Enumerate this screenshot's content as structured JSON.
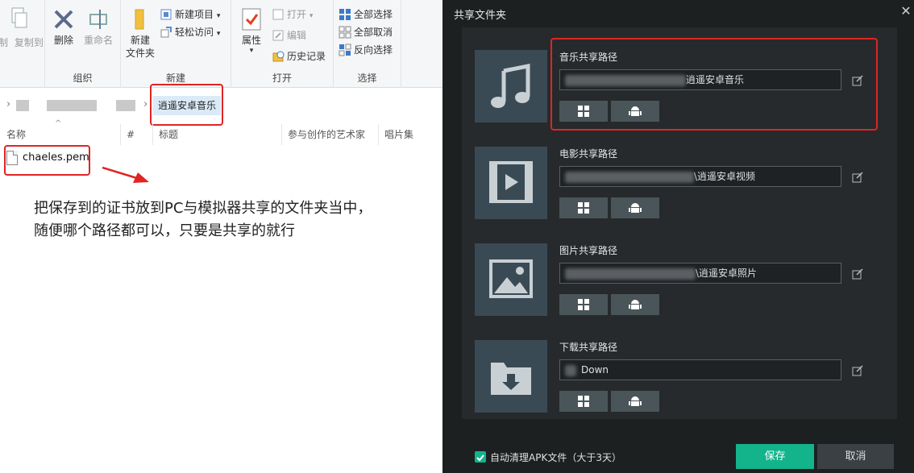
{
  "explorer": {
    "ribbon": {
      "clipboard_partial": [
        "制",
        "复制到"
      ],
      "organize": {
        "delete": "删除",
        "rename": "重命名",
        "group": "组织"
      },
      "new": {
        "new_folder_line1": "新建",
        "new_folder_line2": "文件夹",
        "new_item": "新建项目",
        "easy_access": "轻松访问",
        "group": "新建"
      },
      "open": {
        "properties": "属性",
        "open": "打开",
        "edit": "编辑",
        "history": "历史记录",
        "group": "打开"
      },
      "select": {
        "select_all": "全部选择",
        "select_none": "全部取消",
        "invert": "反向选择",
        "group": "选择"
      }
    },
    "address": {
      "current_folder": "逍遥安卓音乐"
    },
    "columns": {
      "name": "名称",
      "number": "#",
      "title": "标题",
      "artists": "参与创作的艺术家",
      "album": "唱片集"
    },
    "files": [
      {
        "name": "chaeles.pem"
      }
    ],
    "annotation": {
      "line1": "把保存到的证书放到PC与模拟器共享的文件夹当中，",
      "line2": "随便哪个路径都可以，只要是共享的就行"
    },
    "colors": {
      "highlight": "#e02424",
      "ribbon_bg": "#f5f6f7"
    }
  },
  "dialog": {
    "title": "共享文件夹",
    "close_icon": "close-icon",
    "rows": [
      {
        "label": "音乐共享路径",
        "path_tail": "逍遥安卓音乐",
        "icon": "music-note-icon"
      },
      {
        "label": "电影共享路径",
        "path_tail": "\\逍遥安卓视频",
        "icon": "video-icon"
      },
      {
        "label": "图片共享路径",
        "path_tail": "\\逍遥安卓照片",
        "icon": "image-icon"
      },
      {
        "label": "下载共享路径",
        "path_tail": "Down",
        "icon": "download-folder-icon"
      }
    ],
    "auto_clean": {
      "label": "自动清理APK文件（大于3天）",
      "checked": true
    },
    "buttons": {
      "save": "保存",
      "cancel": "取消"
    },
    "colors": {
      "background": "#1d2021",
      "panel": "#262a2c",
      "accent": "#13b38b",
      "thumb": "#3a4a55"
    }
  }
}
